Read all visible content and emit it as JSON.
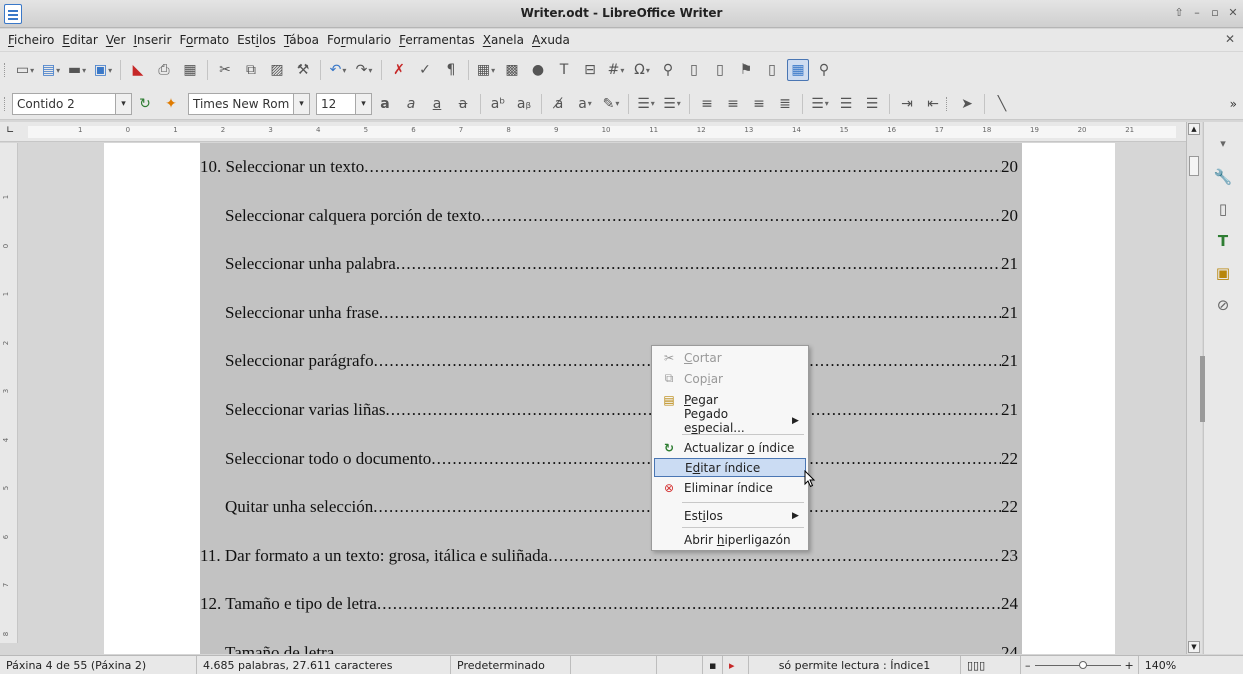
{
  "window": {
    "title": "Writer.odt - LibreOffice Writer"
  },
  "menubar": [
    {
      "pre": "",
      "acc": "F",
      "post": "icheiro"
    },
    {
      "pre": "",
      "acc": "E",
      "post": "ditar"
    },
    {
      "pre": "",
      "acc": "V",
      "post": "er"
    },
    {
      "pre": "",
      "acc": "I",
      "post": "nserir"
    },
    {
      "pre": "F",
      "acc": "o",
      "post": "rmato"
    },
    {
      "pre": "Est",
      "acc": "i",
      "post": "los"
    },
    {
      "pre": "",
      "acc": "T",
      "post": "áboa"
    },
    {
      "pre": "Fo",
      "acc": "r",
      "post": "mulario"
    },
    {
      "pre": "",
      "acc": "F",
      "post": "erramentas"
    },
    {
      "pre": "",
      "acc": "X",
      "post": "anela"
    },
    {
      "pre": "",
      "acc": "A",
      "post": "xuda"
    }
  ],
  "formatting": {
    "paragraph_style": "Contido 2",
    "font_name": "Times New Rom",
    "font_size": "12"
  },
  "ruler_numbers": [
    "1",
    "0",
    "1",
    "2",
    "3",
    "4",
    "5",
    "6",
    "7",
    "8",
    "9",
    "10",
    "11",
    "12",
    "13",
    "14",
    "15",
    "16",
    "17",
    "18",
    "19",
    "20",
    "21"
  ],
  "vruler_numbers": [
    "1",
    "0",
    "1",
    "2",
    "3",
    "4",
    "5",
    "6",
    "7",
    "8"
  ],
  "toc": [
    {
      "text": "10. Seleccionar un texto",
      "page": "20",
      "level": 1
    },
    {
      "text": "Seleccionar calquera porción de texto",
      "page": "20",
      "level": 2
    },
    {
      "text": "Seleccionar unha palabra",
      "page": "21",
      "level": 2
    },
    {
      "text": "Seleccionar unha frase",
      "page": "21",
      "level": 2
    },
    {
      "text": "Seleccionar parágrafo",
      "page": "21",
      "level": 2
    },
    {
      "text": "Seleccionar varias liñas",
      "page": "21",
      "level": 2
    },
    {
      "text": "Seleccionar todo o documento",
      "page": "22",
      "level": 2
    },
    {
      "text": "Quitar unha selección",
      "page": "22",
      "level": 2
    },
    {
      "text": "11. Dar formato a un texto: grosa, itálica e suliñada",
      "page": "23",
      "level": 1
    },
    {
      "text": "12. Tamaño e tipo de letra",
      "page": "24",
      "level": 1
    },
    {
      "text": "Tamaño de letra",
      "page": "24",
      "level": 2
    }
  ],
  "context_menu": {
    "cut": {
      "pre": "",
      "acc": "C",
      "post": "ortar"
    },
    "copy": {
      "pre": "Cop",
      "acc": "i",
      "post": "ar"
    },
    "paste": {
      "pre": "",
      "acc": "P",
      "post": "egar"
    },
    "paste_special": {
      "pre": "Pegado e",
      "acc": "s",
      "post": "pecial..."
    },
    "update_index": {
      "pre": "Actualizar ",
      "acc": "o",
      "post": " índice"
    },
    "edit_index": {
      "pre": "E",
      "acc": "d",
      "post": "itar índice"
    },
    "delete_index": {
      "pre": "Eliminar índice",
      "acc": "",
      "post": ""
    },
    "styles": {
      "pre": "Est",
      "acc": "i",
      "post": "los"
    },
    "open_hyperlink": {
      "pre": "Abrir ",
      "acc": "h",
      "post": "iperligazón"
    }
  },
  "statusbar": {
    "page": "Páxina 4 de 55 (Páxina 2)",
    "words": "4.685 palabras, 27.611 caracteres",
    "page_style": "Predeterminado",
    "section": "só permite lectura : Índice1",
    "zoom": "140%"
  },
  "colors": {
    "toc_background": "#c2c2c2",
    "menu_highlight": "#cbdcf3"
  }
}
